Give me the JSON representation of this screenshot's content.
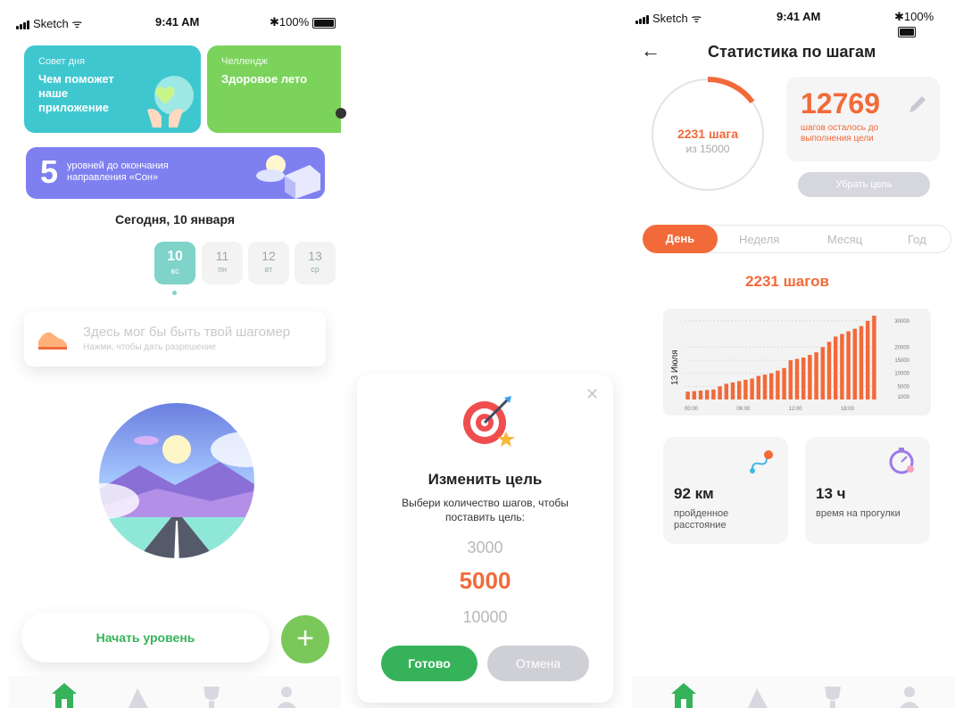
{
  "status": {
    "carrier": "Sketch",
    "time": "9:41 AM",
    "battery": "100%"
  },
  "screen1": {
    "tip_card": {
      "title": "Совет дня",
      "text": "Чем поможет наше приложение"
    },
    "challenge_card": {
      "title": "Челлендж",
      "text": "Здоровое лето"
    },
    "levels_card": {
      "number": "5",
      "text": "уровней до окончания направления «Сон»"
    },
    "date_title": "Сегодня, 10 января",
    "days": [
      {
        "num": "10",
        "wd": "вс"
      },
      {
        "num": "11",
        "wd": "пн"
      },
      {
        "num": "12",
        "wd": "вт"
      },
      {
        "num": "13",
        "wd": "ср"
      }
    ],
    "pedometer": {
      "title": "Здесь мог бы быть твой шагомер",
      "subtitle": "Нажми, чтобы дать разрешение"
    },
    "start_button": "Начать уровень",
    "add_button": "+"
  },
  "modal": {
    "title": "Изменить цель",
    "subtitle": "Выбери количество шагов, чтобы поставить цель:",
    "values": [
      "3000",
      "5000",
      "10000"
    ],
    "done": "Готово",
    "cancel": "Отмена",
    "close": "✕"
  },
  "screen3": {
    "back": "←",
    "title": "Статистика по шагам",
    "ring_value": "2231 шага",
    "ring_of": "из 15000",
    "ring_progress": 0.149,
    "remaining": "12769",
    "remaining_text": "шагов осталось до выполнения цели",
    "remove_goal": "Убрать цель",
    "tabs": [
      "День",
      "Неделя",
      "Месяц",
      "Год"
    ],
    "steps_total": "2231 шагов",
    "distance": "92 км",
    "distance_label": "пройденное расстояние",
    "walk_time": "13 ч",
    "walk_time_label": "время на прогулки"
  },
  "chart_data": {
    "type": "bar",
    "ylabel": "13 Июля",
    "x_ticks": [
      "00:00",
      "06:00",
      "12:00",
      "18:00"
    ],
    "y_ticks": [
      "30000",
      "20000",
      "15000",
      "10000",
      "5000",
      "1000"
    ],
    "values": [
      3000,
      3200,
      3400,
      3600,
      3800,
      5000,
      6000,
      6500,
      7000,
      7500,
      8000,
      9000,
      9500,
      10000,
      11000,
      12000,
      15000,
      15500,
      16000,
      17000,
      18000,
      20000,
      22000,
      24000,
      25000,
      26000,
      27000,
      28000,
      30000,
      32000
    ],
    "ylim": [
      0,
      32000
    ],
    "color": "#f26a3a"
  },
  "colors": {
    "green": "#36b35a",
    "orange": "#f26a3a",
    "teal": "#3fc9c9",
    "lime": "#7bd35c",
    "purple": "#7a7cf0"
  }
}
